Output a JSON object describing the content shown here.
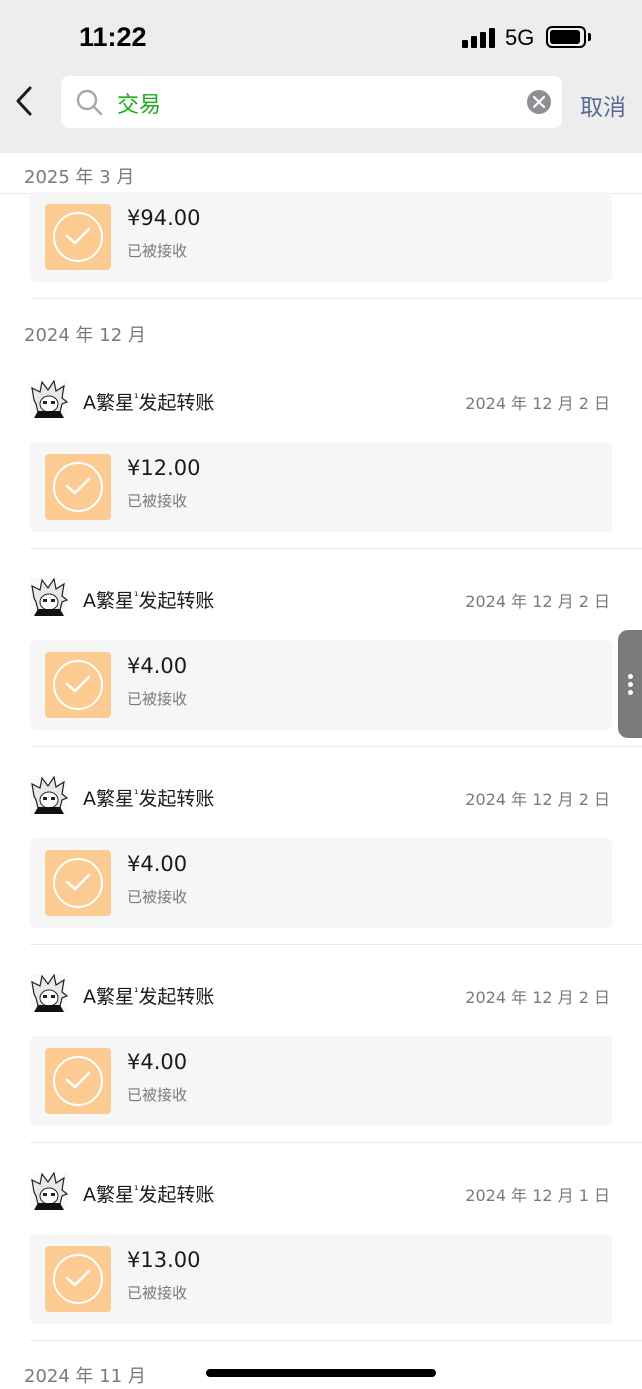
{
  "status_bar": {
    "time": "11:22",
    "network": "5G"
  },
  "search": {
    "query": "交易",
    "cancel_label": "取消"
  },
  "sections": [
    {
      "header": "2025 年 3 月"
    },
    {
      "header": "2024 年 12 月"
    },
    {
      "header": "2024 年 11 月"
    }
  ],
  "transactions": [
    {
      "sender": "",
      "date": "",
      "amount": "¥94.00",
      "status": "已被接收"
    },
    {
      "sender": "A繁星",
      "sender_sup": "¹",
      "sender_suffix": "发起转账",
      "date": "2024 年 12 月 2 日",
      "amount": "¥12.00",
      "status": "已被接收"
    },
    {
      "sender": "A繁星",
      "sender_sup": "¹",
      "sender_suffix": "发起转账",
      "date": "2024 年 12 月 2 日",
      "amount": "¥4.00",
      "status": "已被接收"
    },
    {
      "sender": "A繁星",
      "sender_sup": "¹",
      "sender_suffix": "发起转账",
      "date": "2024 年 12 月 2 日",
      "amount": "¥4.00",
      "status": "已被接收"
    },
    {
      "sender": "A繁星",
      "sender_sup": "¹",
      "sender_suffix": "发起转账",
      "date": "2024 年 12 月 2 日",
      "amount": "¥4.00",
      "status": "已被接收"
    },
    {
      "sender": "A繁星",
      "sender_sup": "¹",
      "sender_suffix": "发起转账",
      "date": "2024 年 12 月 1 日",
      "amount": "¥13.00",
      "status": "已被接收"
    }
  ],
  "colors": {
    "accent_green": "#1aad19",
    "link_blue": "#576b95",
    "transfer_orange": "#fbcb91"
  },
  "icons": [
    "back-chevron-icon",
    "search-icon",
    "clear-icon",
    "transfer-check-icon",
    "avatar-image"
  ]
}
